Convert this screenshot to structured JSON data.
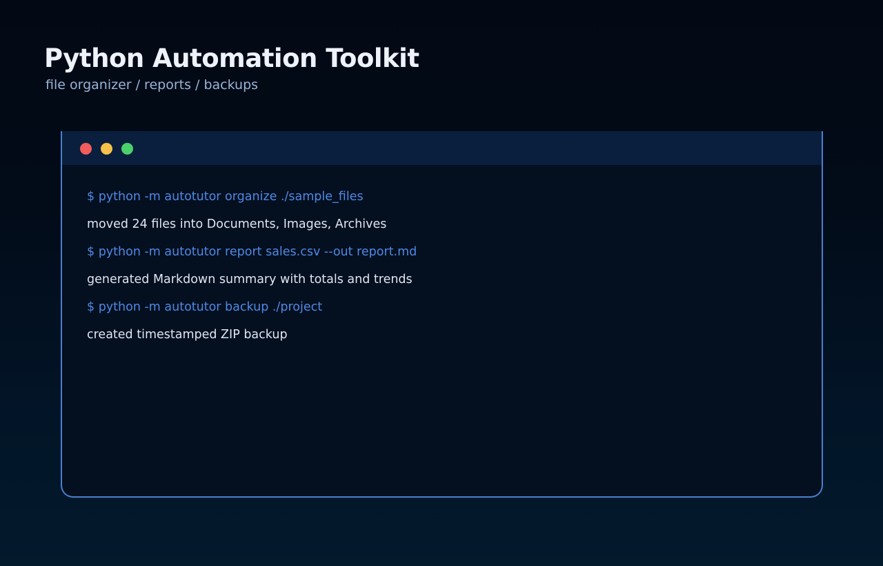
{
  "header": {
    "title": "Python Automation Toolkit",
    "subtitle": "file organizer / reports / backups"
  },
  "terminal": {
    "window_controls": [
      {
        "name": "close",
        "color": "#f25c5c"
      },
      {
        "name": "minimize",
        "color": "#f7c14a"
      },
      {
        "name": "maximize",
        "color": "#4cd06c"
      }
    ],
    "lines": [
      {
        "type": "command",
        "text": "$ python -m autotutor organize ./sample_files"
      },
      {
        "type": "output",
        "text": "moved 24 files into Documents, Images, Archives"
      },
      {
        "type": "command",
        "text": "$ python -m autotutor report sales.csv --out report.md"
      },
      {
        "type": "output",
        "text": "generated Markdown summary with totals and trends"
      },
      {
        "type": "command",
        "text": "$ python -m autotutor backup ./project"
      },
      {
        "type": "output",
        "text": "created timestamped ZIP backup"
      }
    ]
  },
  "colors": {
    "accent": "#4d8ae6",
    "command_text": "#4d8ae6",
    "output_text": "#dfe6f2",
    "titlebar": "#0a1f3d",
    "terminal_bg": "#040f1f"
  }
}
